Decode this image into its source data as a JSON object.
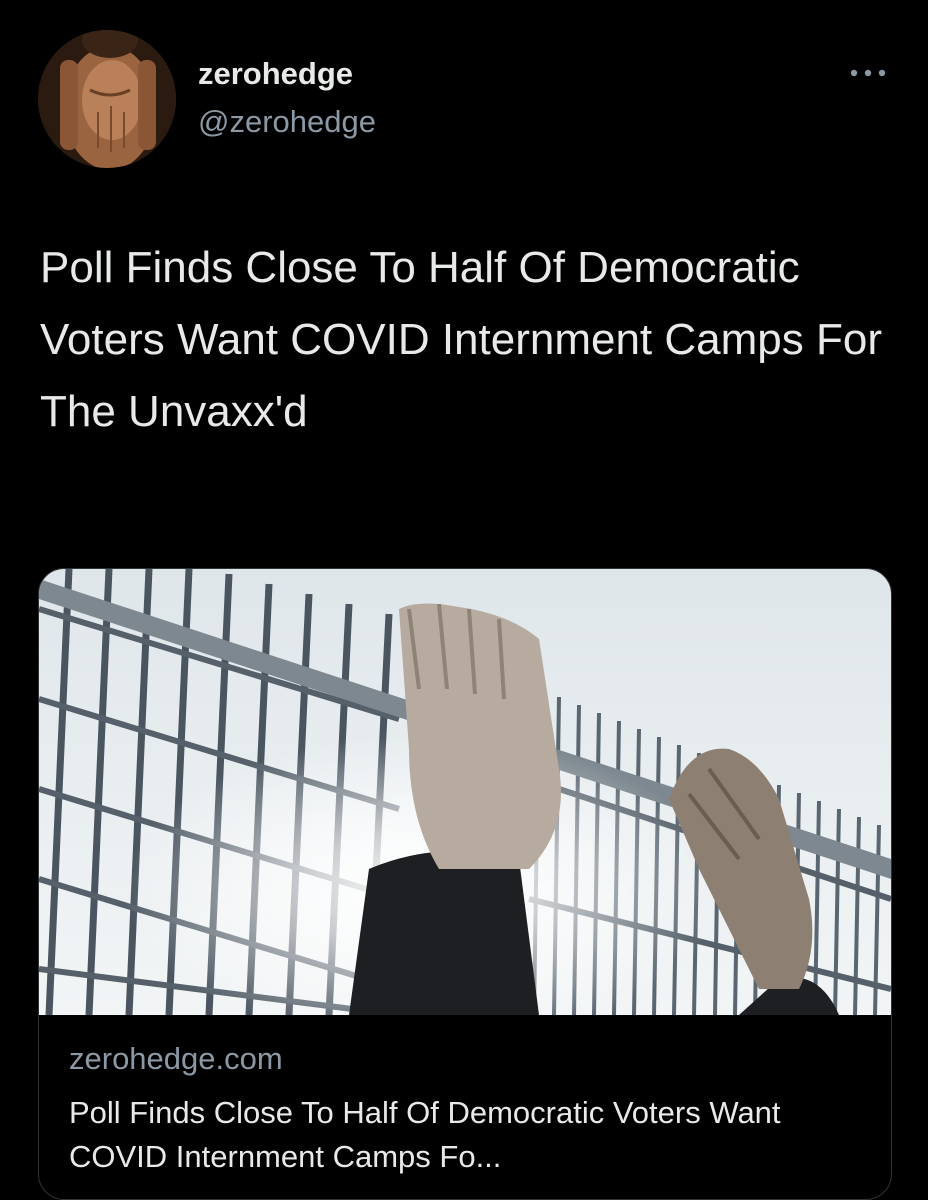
{
  "author": {
    "display_name": "zerohedge",
    "handle": "@zerohedge",
    "avatar_icon": "avatar-photo"
  },
  "tweet": {
    "text": "Poll Finds Close To Half Of Democratic Voters Want COVID Internment Camps For The Unvaxx'd"
  },
  "menu": {
    "icon": "more-horizontal-icon"
  },
  "card": {
    "image_icon": "fence-hands-photo",
    "domain": "zerohedge.com",
    "title": "Poll Finds Close To Half Of Democratic Voters Want COVID Internment Camps Fo..."
  },
  "colors": {
    "background": "#000000",
    "primary_text": "#e7e9ea",
    "secondary_text": "#8b98a5",
    "border": "#2f3336"
  }
}
